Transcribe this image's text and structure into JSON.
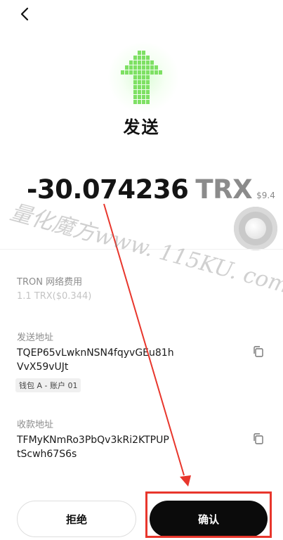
{
  "header": {
    "back_icon": "chevron-left-icon"
  },
  "hero": {
    "icon": "send-arrow-icon",
    "accent_color": "#7ee064"
  },
  "title": "发送",
  "amount": {
    "value": "-30.074236",
    "unit": "TRX",
    "fiat": "$9.4"
  },
  "network_fee": {
    "label": "TRON 网络费用",
    "value": "1.1 TRX($0.344)"
  },
  "sender": {
    "label": "发送地址",
    "address_line1": "TQEP65vLwknNSN4fqyvGEu81h",
    "address_line2": "VvX59vUJt",
    "wallet_tag": "钱包 A - 账户 01",
    "copy_icon": "copy-icon"
  },
  "recipient": {
    "label": "收款地址",
    "address_line1": "TFMyKNmRo3PbQv3kRi2KTPUP",
    "address_line2": "tScwh67S6s",
    "copy_icon": "copy-icon"
  },
  "actions": {
    "reject_label": "拒绝",
    "confirm_label": "确认"
  },
  "annotation": {
    "color": "#e8362c"
  },
  "watermark": "量化魔方www. 115KU. com"
}
